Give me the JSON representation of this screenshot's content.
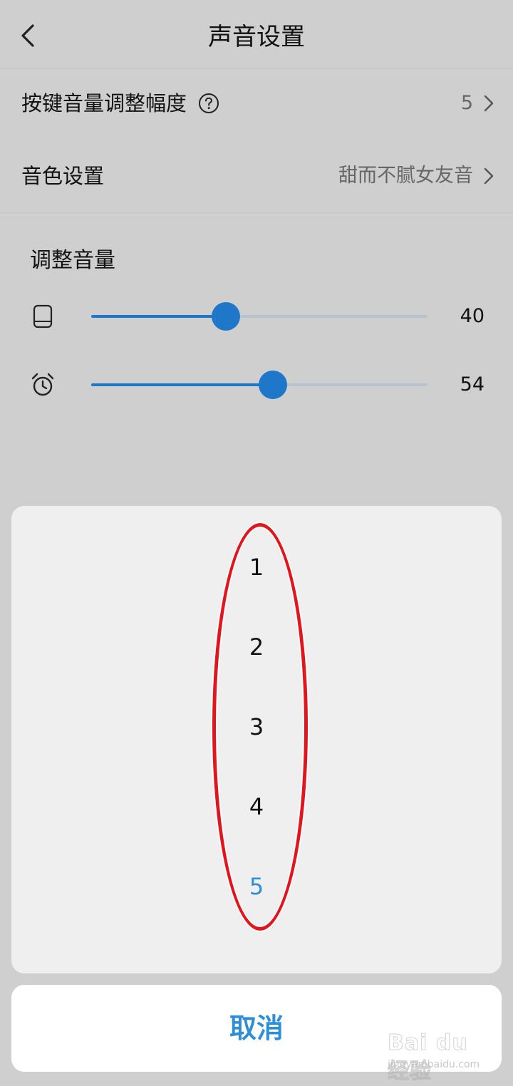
{
  "header": {
    "title": "声音设置",
    "back_icon": "chevron-left-icon"
  },
  "settings": {
    "key_volume_step": {
      "label": "按键音量调整幅度",
      "help_icon": "question-circle-icon",
      "value": "5",
      "chevron_icon": "chevron-right-icon"
    },
    "timbre": {
      "label": "音色设置",
      "value": "甜而不腻女友音",
      "chevron_icon": "chevron-right-icon"
    }
  },
  "volume": {
    "title": "调整音量",
    "sliders": [
      {
        "icon": "tablet-icon",
        "value": "40",
        "level": 0.4
      },
      {
        "icon": "alarm-clock-icon",
        "value": "54",
        "level": 0.54
      }
    ]
  },
  "picker": {
    "options": [
      "1",
      "2",
      "3",
      "4",
      "5"
    ],
    "selected": "5",
    "selected_color": "#2e8fd8",
    "annotation_color": "#e3141b"
  },
  "cancel_label": "取消",
  "watermark": {
    "brand": "Bai du 经验",
    "site": "jingyan.baidu.com"
  },
  "colors": {
    "accent": "#1f77c9",
    "background": "#cfcfcf",
    "sheet": "#efefef"
  }
}
